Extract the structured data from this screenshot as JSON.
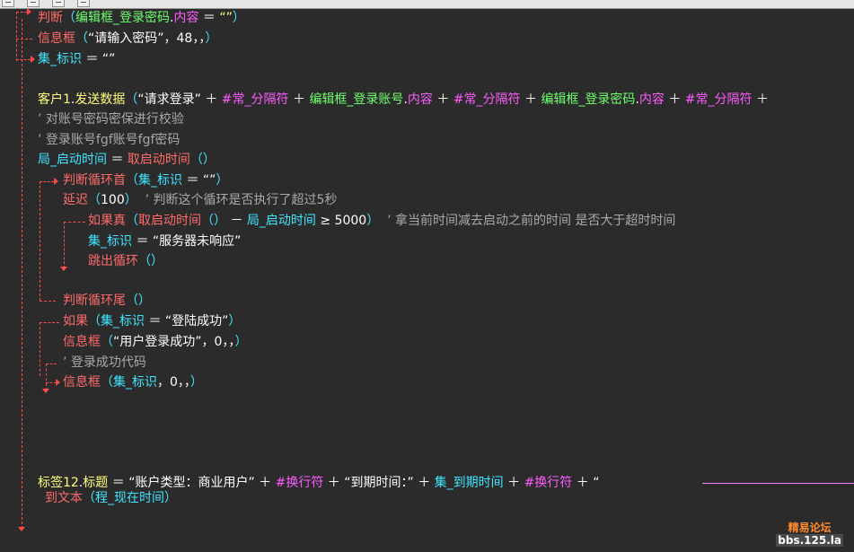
{
  "code": [
    {
      "id": "l1",
      "tokens": [
        {
          "c": "ctrl",
          "t": "判断"
        },
        {
          "c": "kw-cyan",
          "t": "（"
        },
        {
          "c": "kw-green",
          "t": "编辑框_登录密码"
        },
        {
          "c": "txt-white",
          "t": "."
        },
        {
          "c": "kw-magenta",
          "t": "内容"
        },
        {
          "c": "txt-white",
          "t": " ＝ "
        },
        {
          "c": "txt-yellow",
          "t": "“”"
        },
        {
          "c": "kw-cyan",
          "t": "）"
        }
      ]
    },
    {
      "id": "l2",
      "tokens": [
        {
          "c": "ctrl",
          "t": "信息框"
        },
        {
          "c": "kw-cyan",
          "t": "（"
        },
        {
          "c": "txt-white",
          "t": "“请输入密码”"
        },
        {
          "c": "txt-white",
          "t": "，48，，"
        },
        {
          "c": "kw-cyan",
          "t": "）"
        }
      ]
    },
    {
      "id": "l3",
      "tokens": [
        {
          "c": "kw-cyan",
          "t": "集_标识"
        },
        {
          "c": "txt-white",
          "t": " ＝ "
        },
        {
          "c": "txt-white",
          "t": "“”"
        }
      ]
    },
    {
      "id": "l4",
      "tokens": [
        {
          "c": "txt-yellow",
          "t": "客户1"
        },
        {
          "c": "txt-white",
          "t": "."
        },
        {
          "c": "txt-yellow",
          "t": "发送数据"
        },
        {
          "c": "kw-cyan",
          "t": "（"
        },
        {
          "c": "txt-white",
          "t": "“请求登录”"
        },
        {
          "c": "txt-white",
          "t": " ＋ "
        },
        {
          "c": "kw-magenta",
          "t": "#常_分隔符"
        },
        {
          "c": "txt-white",
          "t": " ＋ "
        },
        {
          "c": "kw-green",
          "t": "编辑框_登录账号"
        },
        {
          "c": "txt-white",
          "t": "."
        },
        {
          "c": "kw-magenta",
          "t": "内容"
        },
        {
          "c": "txt-white",
          "t": " ＋ "
        },
        {
          "c": "kw-magenta",
          "t": "#常_分隔符"
        },
        {
          "c": "txt-white",
          "t": " ＋ "
        },
        {
          "c": "kw-green",
          "t": "编辑框_登录密码"
        },
        {
          "c": "txt-white",
          "t": "."
        },
        {
          "c": "kw-magenta",
          "t": "内容"
        },
        {
          "c": "txt-white",
          "t": " ＋ "
        },
        {
          "c": "kw-magenta",
          "t": "#常_分隔符"
        },
        {
          "c": "txt-white",
          "t": " ＋"
        }
      ]
    },
    {
      "id": "l5",
      "tokens": [
        {
          "c": "comment",
          "t": "’ 对账号密码密保进行校验"
        }
      ]
    },
    {
      "id": "l6",
      "tokens": [
        {
          "c": "comment",
          "t": "’ 登录账号fgf账号fgf密码"
        }
      ]
    },
    {
      "id": "l7",
      "tokens": [
        {
          "c": "kw-cyan",
          "t": "局_启动时间"
        },
        {
          "c": "txt-white",
          "t": " ＝ "
        },
        {
          "c": "ctrl",
          "t": "取启动时间"
        },
        {
          "c": "kw-cyan",
          "t": "（）"
        }
      ]
    },
    {
      "id": "l8",
      "tokens": [
        {
          "c": "ctrl",
          "t": "判断循环首"
        },
        {
          "c": "kw-cyan",
          "t": "（"
        },
        {
          "c": "kw-cyan",
          "t": "集_标识"
        },
        {
          "c": "txt-white",
          "t": " ＝ "
        },
        {
          "c": "txt-white",
          "t": "“”"
        },
        {
          "c": "kw-cyan",
          "t": "）"
        }
      ]
    },
    {
      "id": "l9",
      "tokens": [
        {
          "c": "ctrl",
          "t": "延迟"
        },
        {
          "c": "kw-cyan",
          "t": "（"
        },
        {
          "c": "txt-white",
          "t": "100"
        },
        {
          "c": "kw-cyan",
          "t": "）"
        },
        {
          "c": "comment",
          "t": "  ’ 判断这个循环是否执行了超过5秒"
        }
      ]
    },
    {
      "id": "l10",
      "tokens": [
        {
          "c": "ctrl",
          "t": "如果真"
        },
        {
          "c": "kw-cyan",
          "t": "（"
        },
        {
          "c": "ctrl",
          "t": "取启动时间"
        },
        {
          "c": "kw-cyan",
          "t": "（）"
        },
        {
          "c": "txt-white",
          "t": " － "
        },
        {
          "c": "kw-cyan",
          "t": "局_启动时间"
        },
        {
          "c": "txt-white",
          "t": " ≥ "
        },
        {
          "c": "txt-white",
          "t": "5000"
        },
        {
          "c": "kw-cyan",
          "t": "）"
        },
        {
          "c": "comment",
          "t": "  ’ 拿当前时间减去启动之前的时间 是否大于超时时间"
        }
      ]
    },
    {
      "id": "l11",
      "tokens": [
        {
          "c": "kw-cyan",
          "t": "集_标识"
        },
        {
          "c": "txt-white",
          "t": " ＝ "
        },
        {
          "c": "txt-white",
          "t": "“服务器未响应”"
        }
      ]
    },
    {
      "id": "l12",
      "tokens": [
        {
          "c": "ctrl",
          "t": "跳出循环"
        },
        {
          "c": "kw-cyan",
          "t": "（）"
        }
      ]
    },
    {
      "id": "l13",
      "tokens": [
        {
          "c": "ctrl",
          "t": "判断循环尾"
        },
        {
          "c": "kw-cyan",
          "t": "（）"
        }
      ]
    },
    {
      "id": "l14",
      "tokens": [
        {
          "c": "ctrl",
          "t": "如果"
        },
        {
          "c": "kw-cyan",
          "t": "（"
        },
        {
          "c": "kw-cyan",
          "t": "集_标识"
        },
        {
          "c": "txt-white",
          "t": " ＝ "
        },
        {
          "c": "txt-white",
          "t": "“登陆成功”"
        },
        {
          "c": "kw-cyan",
          "t": "）"
        }
      ]
    },
    {
      "id": "l15",
      "tokens": [
        {
          "c": "ctrl",
          "t": "信息框"
        },
        {
          "c": "kw-cyan",
          "t": "（"
        },
        {
          "c": "txt-white",
          "t": "“用户登录成功”"
        },
        {
          "c": "txt-white",
          "t": "，0，，"
        },
        {
          "c": "kw-cyan",
          "t": "）"
        }
      ]
    },
    {
      "id": "l16",
      "tokens": [
        {
          "c": "comment",
          "t": "’ 登录成功代码"
        }
      ]
    },
    {
      "id": "l17",
      "tokens": [
        {
          "c": "ctrl",
          "t": "信息框"
        },
        {
          "c": "kw-cyan",
          "t": "（"
        },
        {
          "c": "kw-cyan",
          "t": "集_标识"
        },
        {
          "c": "txt-white",
          "t": "，0，，"
        },
        {
          "c": "kw-cyan",
          "t": "）"
        }
      ]
    },
    {
      "id": "l18",
      "tokens": [
        {
          "c": "txt-yellow",
          "t": "标签12"
        },
        {
          "c": "txt-white",
          "t": "."
        },
        {
          "c": "txt-yellow",
          "t": "标题"
        },
        {
          "c": "txt-white",
          "t": " ＝ "
        },
        {
          "c": "txt-white",
          "t": "“账户类型：商业用户”"
        },
        {
          "c": "txt-white",
          "t": " ＋ "
        },
        {
          "c": "kw-magenta",
          "t": "#换行符"
        },
        {
          "c": "txt-white",
          "t": " ＋ "
        },
        {
          "c": "txt-white",
          "t": "“到期时间：”"
        },
        {
          "c": "txt-white",
          "t": " ＋ "
        },
        {
          "c": "kw-cyan",
          "t": "集_到期时间"
        },
        {
          "c": "txt-white",
          "t": " ＋ "
        },
        {
          "c": "kw-magenta",
          "t": "#换行符"
        },
        {
          "c": "txt-white",
          "t": " ＋ "
        },
        {
          "c": "txt-white",
          "t": "“"
        }
      ]
    },
    {
      "id": "l19",
      "tokens": [
        {
          "c": "ctrl",
          "t": "到文本"
        },
        {
          "c": "kw-cyan",
          "t": "（"
        },
        {
          "c": "kw-cyan",
          "t": "程_现在时间"
        },
        {
          "c": "kw-cyan",
          "t": "）"
        }
      ]
    }
  ],
  "watermark": {
    "line1": "精易论坛",
    "line2": "bbs.125.la"
  },
  "colors": {
    "background": "#2b2b2b",
    "flow_lines": "#ff4a4a",
    "control_keyword": "#ff6b6b",
    "component": "#6dff6d",
    "property": "#ff5bff",
    "variable": "#3fe6ff",
    "comment": "#a9a9a9"
  }
}
